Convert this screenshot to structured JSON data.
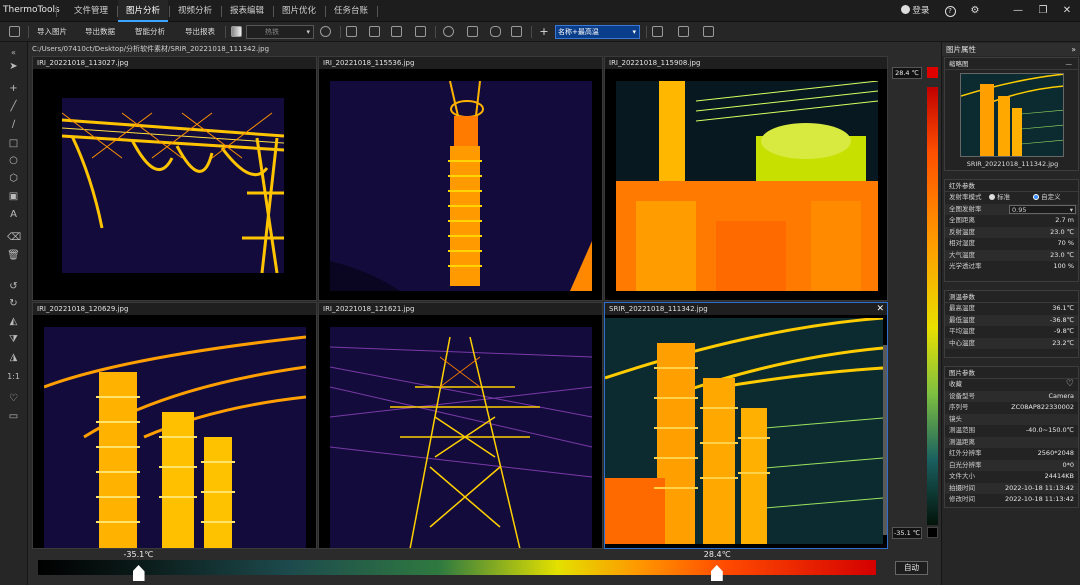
{
  "app": {
    "name": "ThermoTools"
  },
  "tabs": [
    "文件管理",
    "图片分析",
    "视频分析",
    "报表编辑",
    "图片优化",
    "任务台账"
  ],
  "topright": {
    "login": "登录",
    "help": "?",
    "gear": "⚙",
    "min": "—",
    "max": "❐",
    "close": "✕"
  },
  "toolbar": {
    "import": "导入图片",
    "export_data": "导出数据",
    "smart": "智能分析",
    "export_report": "导出报表",
    "palette": "热铁",
    "region_mode": "名称+最高温"
  },
  "path": "C:/Users/07410ct/Desktop/分析软件素材/SRIR_20221018_111342.jpg",
  "panels": [
    {
      "title": "IRI_20221018_113027.jpg"
    },
    {
      "title": "IRI_20221018_115536.jpg"
    },
    {
      "title": "IRI_20221018_115908.jpg"
    },
    {
      "title": "IRI_20221018_120629.jpg"
    },
    {
      "title": "IRI_20221018_121621.jpg"
    },
    {
      "title": "SRIR_20221018_111342.jpg",
      "close": "✕"
    }
  ],
  "scale": {
    "max": "28.4 ℃",
    "min": "-35.1 ℃",
    "bar_min": "-35.1℃",
    "bar_max": "28.4℃",
    "auto": "自动",
    "min_pos": 0.12,
    "max_pos": 0.81
  },
  "props": {
    "title": "图片属性",
    "expand": "»",
    "thumb": {
      "title": "缩略图",
      "caption": "SRIR_20221018_111342.jpg",
      "collapse": "—"
    },
    "ir": {
      "title": "红外参数",
      "emis_mode": "发射率模式",
      "std": "标准",
      "custom": "自定义",
      "global_emis": "全图发射率",
      "emis": "0.95",
      "rows": [
        [
          "全图距离",
          "2.7 m"
        ],
        [
          "反射温度",
          "23.0 ℃"
        ],
        [
          "相对湿度",
          "70 %"
        ],
        [
          "大气温度",
          "23.0 ℃"
        ],
        [
          "光学透过率",
          "100 %"
        ]
      ]
    },
    "temp": {
      "title": "测温参数",
      "rows": [
        [
          "最高温度",
          "36.1℃"
        ],
        [
          "最低温度",
          "-36.8℃"
        ],
        [
          "平均温度",
          "-9.8℃"
        ],
        [
          "中心温度",
          "23.2℃"
        ]
      ]
    },
    "img": {
      "title": "图片参数",
      "rows": [
        [
          "收藏",
          "♡"
        ],
        [
          "设备型号",
          "Camera"
        ],
        [
          "序列号",
          "ZC08AP822330002"
        ],
        [
          "镜头",
          ""
        ],
        [
          "测温范围",
          "-40.0~150.0℃"
        ],
        [
          "测温距离",
          ""
        ],
        [
          "红外分辨率",
          "2560*2048"
        ],
        [
          "白光分辨率",
          "0*0"
        ],
        [
          "文件大小",
          "24414KB"
        ],
        [
          "拍摄时间",
          "2022-10-18 11:13:42"
        ],
        [
          "修改时间",
          "2022-10-18 11:13:42"
        ]
      ]
    }
  }
}
